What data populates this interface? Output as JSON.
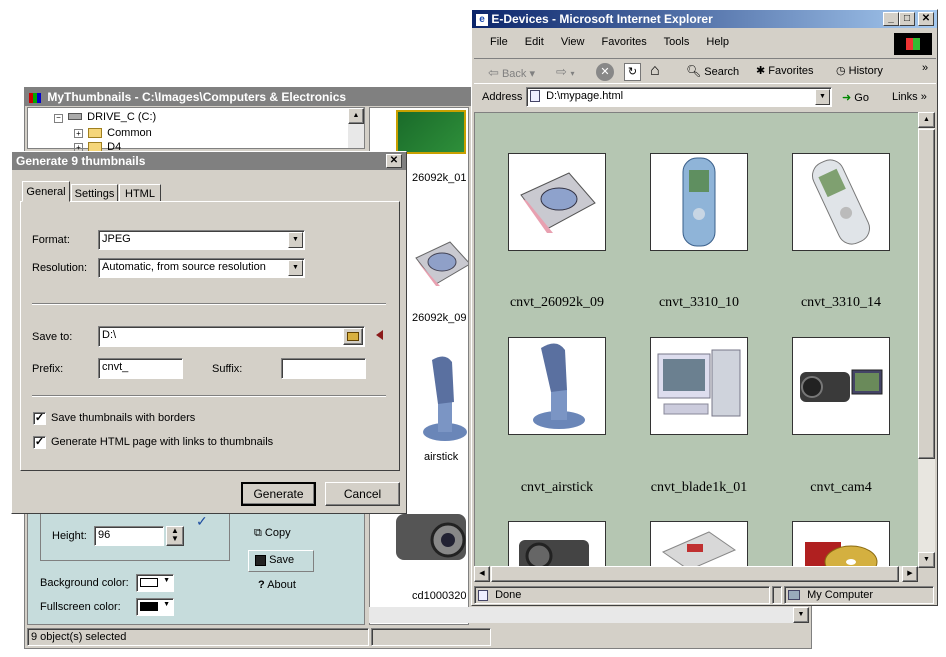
{
  "mythumbs": {
    "title": "MyThumbnails - C:\\Images\\Computers & Electronics",
    "tree": [
      "DRIVE_C (C:)",
      "Common",
      "D4"
    ],
    "thumb_labels": [
      "26092k_01",
      "26092k_09",
      "airstick",
      "cd1000320"
    ],
    "height_label": "Height:",
    "height_value": "96",
    "bg_color_label": "Background color:",
    "fs_color_label": "Fullscreen color:",
    "copy_label": "Copy",
    "save_label": "Save",
    "about_label": "About",
    "status": "9 object(s) selected"
  },
  "dialog": {
    "title": "Generate 9 thumbnails",
    "tabs": [
      "General",
      "Settings",
      "HTML"
    ],
    "format_label": "Format:",
    "format_value": "JPEG",
    "resolution_label": "Resolution:",
    "resolution_value": "Automatic, from source resolution",
    "save_to_label": "Save to:",
    "save_to_value": "D:\\",
    "prefix_label": "Prefix:",
    "prefix_value": "cnvt_",
    "suffix_label": "Suffix:",
    "suffix_value": "",
    "chk_borders": "Save thumbnails with borders",
    "chk_html": "Generate HTML page with links to thumbnails",
    "generate": "Generate",
    "cancel": "Cancel"
  },
  "ie": {
    "title": "E-Devices - Microsoft Internet Explorer",
    "menu": [
      "File",
      "Edit",
      "View",
      "Favorites",
      "Tools",
      "Help"
    ],
    "back": "Back",
    "search": "Search",
    "favorites": "Favorites",
    "history": "History",
    "address_label": "Address",
    "address_value": "D:\\mypage.html",
    "go": "Go",
    "links": "Links",
    "captions": [
      "cnvt_26092k_09",
      "cnvt_3310_10",
      "cnvt_3310_14",
      "cnvt_airstick",
      "cnvt_blade1k_01",
      "cnvt_cam4"
    ],
    "status_left": "Done",
    "status_right": "My Computer"
  },
  "colors": {
    "title_active": "#0a246a",
    "title_inactive": "#808080",
    "page_bg": "#b5c6b2",
    "panel_bg": "#c6dcdc",
    "face": "#d4d0c8"
  }
}
